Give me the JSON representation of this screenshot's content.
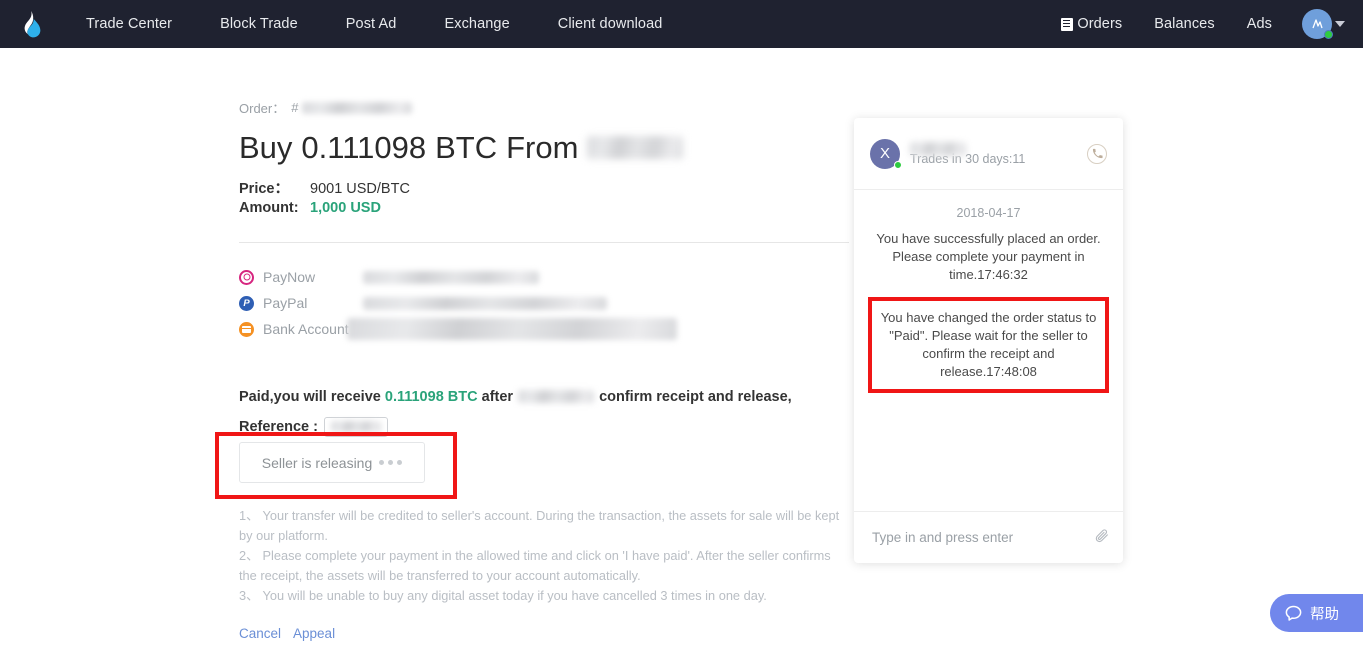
{
  "navbar": {
    "logo_name": "flame-logo",
    "left_links": [
      {
        "label": "Trade Center"
      },
      {
        "label": "Block Trade"
      },
      {
        "label": "Post Ad"
      },
      {
        "label": "Exchange"
      },
      {
        "label": "Client download"
      }
    ],
    "right_links": [
      {
        "label": "Orders",
        "icon": "orders-list-icon"
      },
      {
        "label": "Balances"
      },
      {
        "label": "Ads"
      }
    ],
    "avatar_status": "online"
  },
  "order": {
    "order_label": "Order：",
    "order_hash": "#",
    "order_id_redacted": true,
    "title_prefix": "Buy",
    "amount_btc": "0.111098",
    "asset": "BTC",
    "title_from": "From",
    "seller_redacted": true,
    "price_label": "Price：",
    "price_value": "9001 USD/BTC",
    "amount_label": "Amount:",
    "amount_value": "1,000 USD"
  },
  "payment_methods": [
    {
      "name": "PayNow",
      "icon": "paynow-icon",
      "color": "#d6257f",
      "value_redacted": true
    },
    {
      "name": "PayPal",
      "icon": "paypal-icon",
      "color": "#2f5fb4",
      "value_redacted": true
    },
    {
      "name": "Bank Account",
      "icon": "bank-account-icon",
      "color": "#f59123",
      "value_redacted": true
    }
  ],
  "paid_notice": {
    "part1": "Paid,you will receive",
    "amount": "0.111098 BTC",
    "part2": "after",
    "part3": "confirm receipt and release,",
    "reference_label": "Reference :",
    "reference_redacted": true
  },
  "release": {
    "button_label": "Seller is releasing",
    "dots": 3,
    "highlighted": true,
    "highlight_color": "#f01616"
  },
  "notes": [
    "1、 Your transfer will be credited to seller's account. During the transaction, the assets for sale will be kept by our platform.",
    "2、 Please complete your payment in the allowed time and click on 'I have paid'. After the seller confirms the receipt, the assets will be transferred to your account automatically.",
    "3、 You will be unable to buy any digital asset today if you have cancelled 3 times in one day."
  ],
  "actions": [
    {
      "label": "Cancel"
    },
    {
      "label": "Appeal"
    }
  ],
  "chat": {
    "avatar_initial": "X",
    "name_redacted": true,
    "trades_text": "Trades in 30 days:11",
    "call_icon": "phone-icon",
    "date": "2018-04-17",
    "messages": [
      {
        "text": "You have successfully placed an order. Please complete your payment in time.17:46:32",
        "highlighted": false
      },
      {
        "text": "You have changed the order status to \"Paid\". Please wait for the seller to confirm the receipt and release.17:48:08",
        "highlighted": true
      }
    ],
    "input_placeholder": "Type in and press enter",
    "attach_icon": "paperclip-icon"
  },
  "help_widget": {
    "label": "帮助",
    "icon": "chat-bubble-icon",
    "color": "#7187ec"
  }
}
